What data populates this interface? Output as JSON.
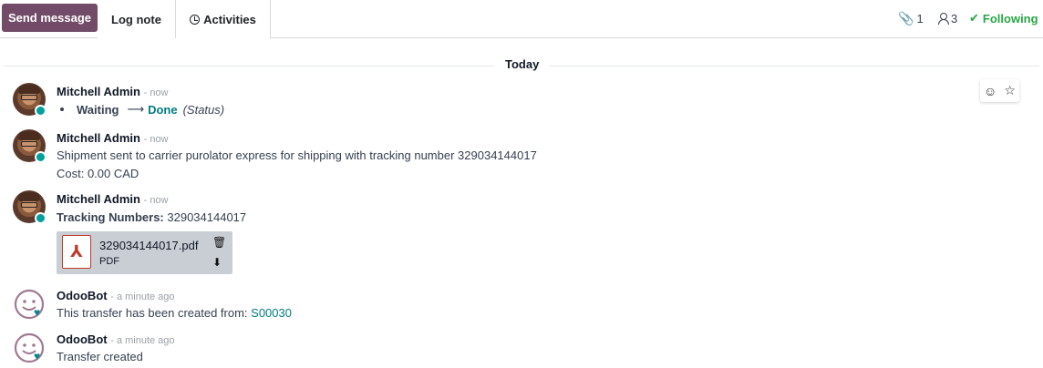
{
  "toolbar": {
    "send_label": "Send message",
    "log_label": "Log note",
    "activities_label": "Activities",
    "attachments_count": "1",
    "followers_count": "3",
    "following_label": "Following"
  },
  "separator": {
    "label": "Today"
  },
  "colors": {
    "brand": "#714b67",
    "accent": "#017e84",
    "following": "#28a745",
    "online": "#00a09d"
  },
  "messages": [
    {
      "author": "Mitchell Admin",
      "time": "- now",
      "tracking": {
        "old": "Waiting",
        "new": "Done",
        "field": "(Status)"
      }
    },
    {
      "author": "Mitchell Admin",
      "time": "- now",
      "line1": "Shipment sent to carrier purolator express for shipping with tracking number 329034144017",
      "line2": "Cost: 0.00 CAD"
    },
    {
      "author": "Mitchell Admin",
      "time": "- now",
      "label": "Tracking Numbers:",
      "value": " 329034144017",
      "attachment": {
        "name": "329034144017.pdf",
        "type": "PDF"
      }
    },
    {
      "author": "OdooBot",
      "time": "- a minute ago",
      "text": "This transfer has been created from: ",
      "link": "S00030"
    },
    {
      "author": "OdooBot",
      "time": "- a minute ago",
      "text": "Transfer created"
    }
  ],
  "icons": {
    "clock": "clock-icon",
    "paperclip": "paperclip-icon",
    "followers": "user-icon",
    "check": "check-icon",
    "smile": "smile-icon",
    "star": "star-icon",
    "trash": "trash-icon",
    "download": "download-icon",
    "pdf": "pdf-icon"
  }
}
